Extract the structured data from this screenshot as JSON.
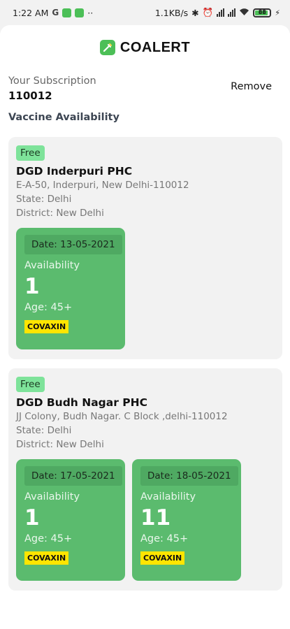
{
  "status_bar": {
    "time": "1:22 AM",
    "g_label": "G",
    "speed": "1.1KB/s",
    "battery": "88"
  },
  "header": {
    "app_name": "COALERT",
    "logo_icon": "syringe-icon",
    "brand_color": "#4cbf57"
  },
  "subscription": {
    "label": "Your Subscription",
    "code": "110012",
    "remove_label": "Remove"
  },
  "section_title": "Vaccine Availability",
  "centers": [
    {
      "badge": "Free",
      "name": "DGD Inderpuri PHC",
      "address": "E-A-50, Inderpuri, New Delhi-110012",
      "state": "State: Delhi",
      "district": "District: New Delhi",
      "slots": [
        {
          "date": "Date: 13-05-2021",
          "availability_label": "Availability",
          "count": "1",
          "age": "Age: 45+",
          "vaccine": "COVAXIN"
        }
      ]
    },
    {
      "badge": "Free",
      "name": "DGD Budh Nagar PHC",
      "address": "JJ Colony, Budh Nagar. C Block ,delhi-110012",
      "state": "State: Delhi",
      "district": "District: New Delhi",
      "slots": [
        {
          "date": "Date: 17-05-2021",
          "availability_label": "Availability",
          "count": "1",
          "age": "Age: 45+",
          "vaccine": "COVAXIN"
        },
        {
          "date": "Date: 18-05-2021",
          "availability_label": "Availability",
          "count": "11",
          "age": "Age: 45+",
          "vaccine": "COVAXIN"
        }
      ]
    }
  ],
  "colors": {
    "slot_green": "#5bbb6e",
    "badge_green": "#7ee39a",
    "vaccine_yellow": "#ffe500"
  }
}
